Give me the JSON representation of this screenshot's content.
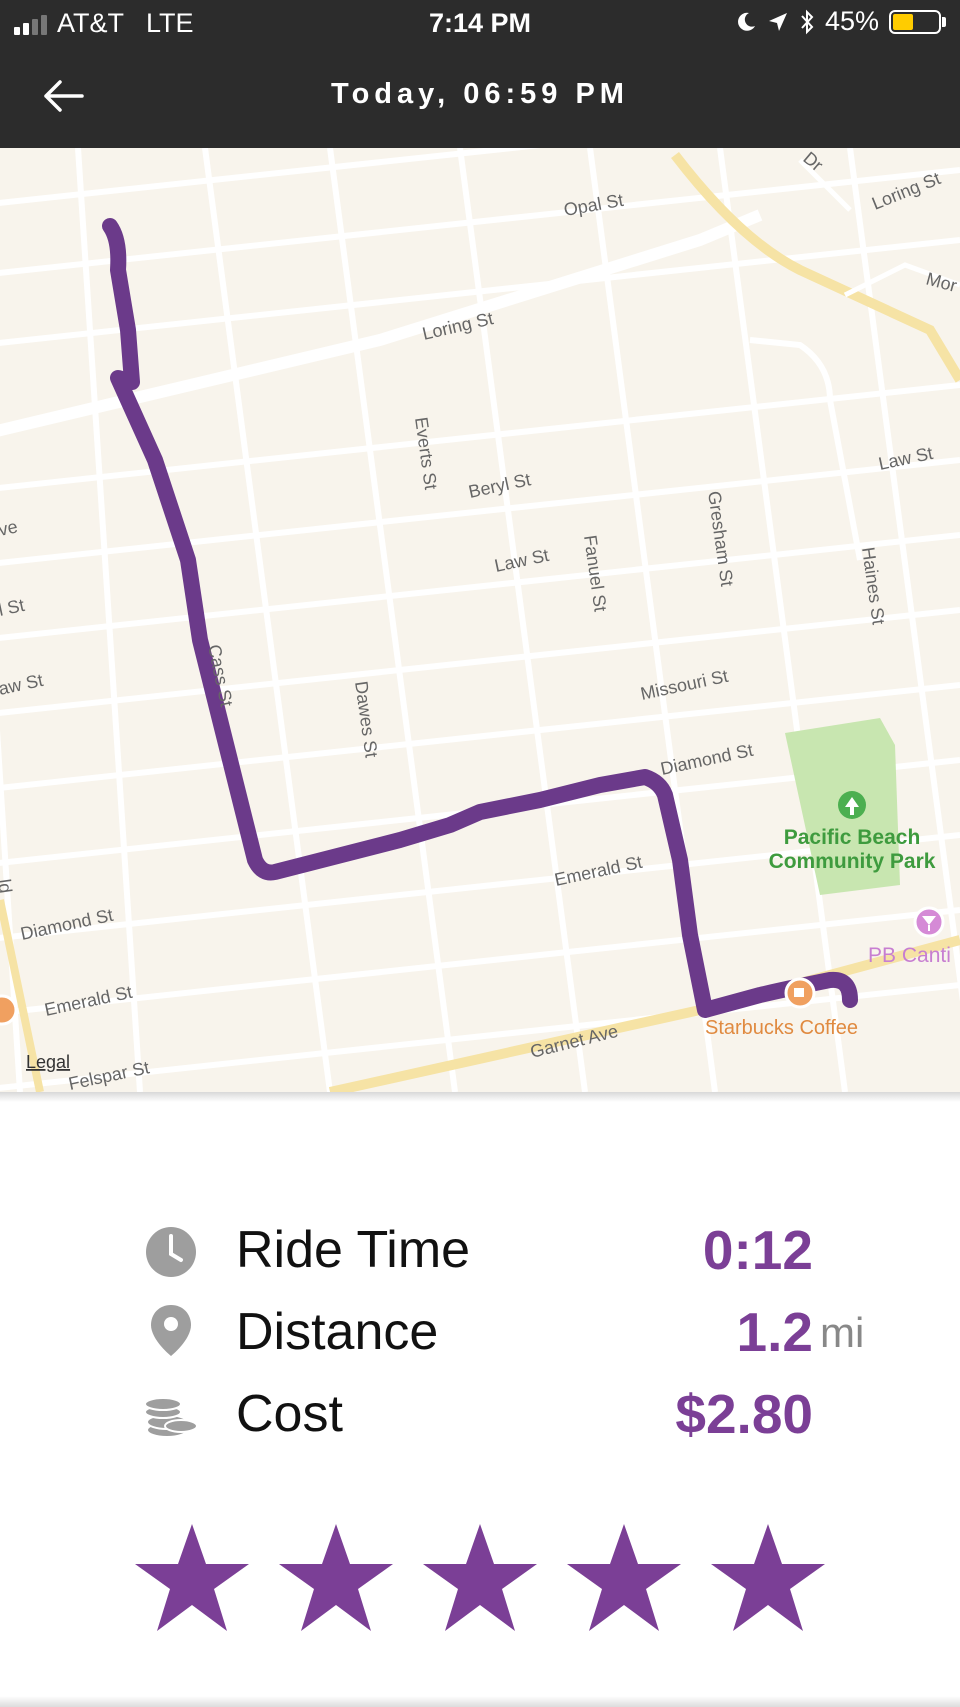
{
  "status_bar": {
    "carrier": "AT&T",
    "network": "LTE",
    "time": "7:14 PM",
    "battery_percent": "45%",
    "battery_level": 0.45,
    "icons": [
      "moon-icon",
      "location-arrow-icon",
      "bluetooth-icon",
      "battery-icon"
    ]
  },
  "header": {
    "title": "Today, 06:59 PM",
    "back_icon": "arrow-left-icon"
  },
  "map": {
    "streets": {
      "opal": "Opal St",
      "loring_top": "Loring St",
      "mor": "Mor",
      "loring": "Loring St",
      "everts": "Everts St",
      "beryl": "Beryl St",
      "law_right": "Law St",
      "law": "Law St",
      "fanuel": "Fanuel St",
      "gresham": "Gresham St",
      "haines": "Haines St",
      "ave": "ve",
      "l_st": "l St",
      "aw_st": "aw St",
      "cass": "Cass St",
      "dawes": "Dawes St",
      "missouri": "Missouri St",
      "diamond_right": "Diamond St",
      "emerald_right": "Emerald St",
      "diamond_left": "Diamond St",
      "emerald_left": "Emerald St",
      "garnet": "Garnet Ave",
      "felspar": "Felspar St",
      "dr": "Dr",
      "ld": "ld"
    },
    "poi": {
      "park_line1": "Pacific Beach",
      "park_line2": "Community Park",
      "cantina": "PB Canti",
      "starbucks": "Starbucks Coffee"
    },
    "legal": "Legal",
    "route_color": "#6b3a8a"
  },
  "stats": {
    "ride_time": {
      "label": "Ride Time",
      "value": "0:12",
      "icon": "clock-icon"
    },
    "distance": {
      "label": "Distance",
      "value": "1.2",
      "unit": "mi",
      "icon": "map-pin-icon"
    },
    "cost": {
      "label": "Cost",
      "value": "$2.80",
      "icon": "coins-icon"
    }
  },
  "rating": {
    "stars": 5,
    "max": 5,
    "color": "#7b3f96"
  }
}
